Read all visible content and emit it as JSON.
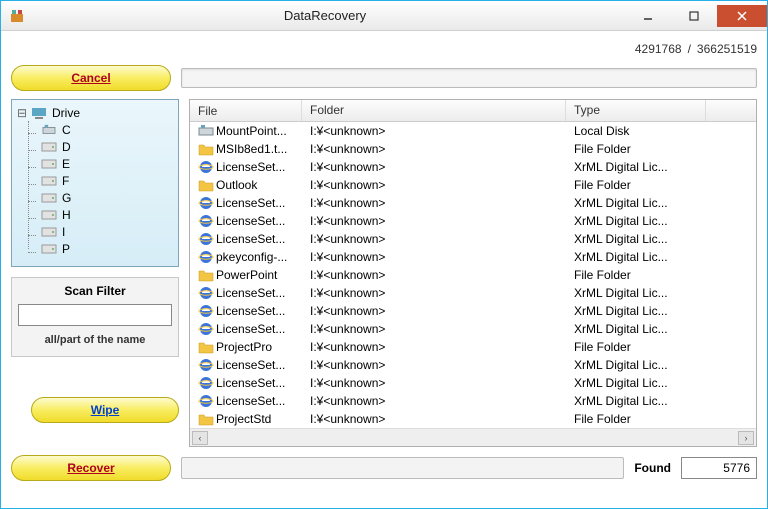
{
  "window": {
    "title": "DataRecovery"
  },
  "counters": {
    "current": "4291768",
    "separator": "/",
    "total": "366251519"
  },
  "buttons": {
    "cancel": "Cancel",
    "wipe": "Wipe",
    "recover": "Recover"
  },
  "tree": {
    "root": "Drive",
    "items": [
      "C",
      "D",
      "E",
      "F",
      "G",
      "H",
      "I",
      "P"
    ]
  },
  "filter": {
    "title": "Scan Filter",
    "value": "",
    "placeholder": "",
    "hint": "all/part of the name"
  },
  "columns": {
    "file": "File",
    "folder": "Folder",
    "type": "Type"
  },
  "rows": [
    {
      "icon": "local",
      "file": "MountPoint...",
      "folder": "I:¥<unknown>",
      "type": "Local Disk"
    },
    {
      "icon": "folder",
      "file": "MSIb8ed1.t...",
      "folder": "I:¥<unknown>",
      "type": "File Folder"
    },
    {
      "icon": "ie",
      "file": "LicenseSet...",
      "folder": "I:¥<unknown>",
      "type": "XrML Digital Lic..."
    },
    {
      "icon": "folder",
      "file": "Outlook",
      "folder": "I:¥<unknown>",
      "type": "File Folder"
    },
    {
      "icon": "ie",
      "file": "LicenseSet...",
      "folder": "I:¥<unknown>",
      "type": "XrML Digital Lic..."
    },
    {
      "icon": "ie",
      "file": "LicenseSet...",
      "folder": "I:¥<unknown>",
      "type": "XrML Digital Lic..."
    },
    {
      "icon": "ie",
      "file": "LicenseSet...",
      "folder": "I:¥<unknown>",
      "type": "XrML Digital Lic..."
    },
    {
      "icon": "ie",
      "file": "pkeyconfig-...",
      "folder": "I:¥<unknown>",
      "type": "XrML Digital Lic..."
    },
    {
      "icon": "folder",
      "file": "PowerPoint",
      "folder": "I:¥<unknown>",
      "type": "File Folder"
    },
    {
      "icon": "ie",
      "file": "LicenseSet...",
      "folder": "I:¥<unknown>",
      "type": "XrML Digital Lic..."
    },
    {
      "icon": "ie",
      "file": "LicenseSet...",
      "folder": "I:¥<unknown>",
      "type": "XrML Digital Lic..."
    },
    {
      "icon": "ie",
      "file": "LicenseSet...",
      "folder": "I:¥<unknown>",
      "type": "XrML Digital Lic..."
    },
    {
      "icon": "folder",
      "file": "ProjectPro",
      "folder": "I:¥<unknown>",
      "type": "File Folder"
    },
    {
      "icon": "ie",
      "file": "LicenseSet...",
      "folder": "I:¥<unknown>",
      "type": "XrML Digital Lic..."
    },
    {
      "icon": "ie",
      "file": "LicenseSet...",
      "folder": "I:¥<unknown>",
      "type": "XrML Digital Lic..."
    },
    {
      "icon": "ie",
      "file": "LicenseSet...",
      "folder": "I:¥<unknown>",
      "type": "XrML Digital Lic..."
    },
    {
      "icon": "folder",
      "file": "ProjectStd",
      "folder": "I:¥<unknown>",
      "type": "File Folder"
    }
  ],
  "found": {
    "label": "Found",
    "value": "5776"
  }
}
